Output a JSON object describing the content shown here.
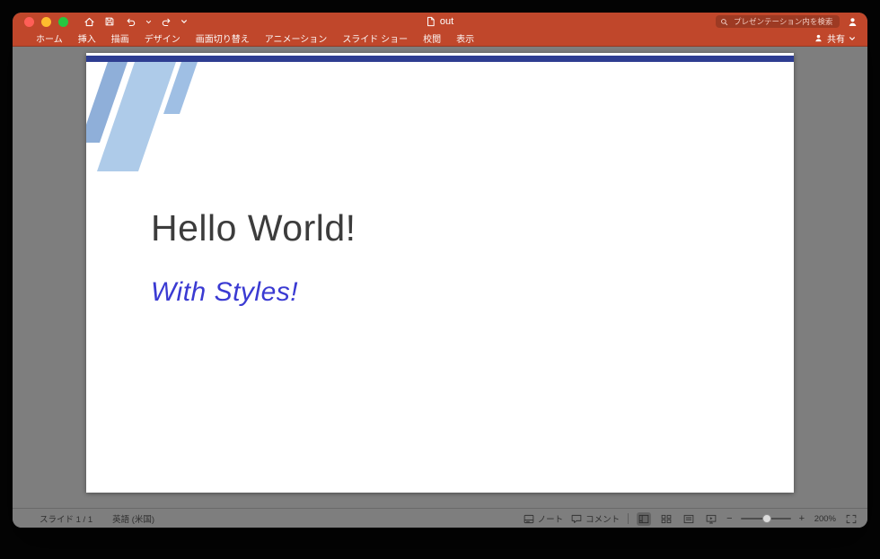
{
  "colors": {
    "titlebar_red": "#C0472B",
    "canvas_gray": "#7E7E7E",
    "slide_accent_navy": "#2E3D91",
    "stripe_medium_blue": "#8FAFD9",
    "stripe_light_blue": "#AECBE9",
    "stripe_soft_blue": "#9FBFE4",
    "slide_title_color": "#3C3C3C",
    "slide_subtitle_color": "#3A3AD2"
  },
  "titlebar": {
    "document_title": "out",
    "search_placeholder": "プレゼンテーション内を検索"
  },
  "ribbon": {
    "tabs": [
      {
        "label": "ホーム"
      },
      {
        "label": "挿入"
      },
      {
        "label": "描画"
      },
      {
        "label": "デザイン"
      },
      {
        "label": "画面切り替え"
      },
      {
        "label": "アニメーション"
      },
      {
        "label": "スライド ショー"
      },
      {
        "label": "校閲"
      },
      {
        "label": "表示"
      }
    ],
    "share_label": "共有"
  },
  "slide": {
    "title": "Hello World!",
    "subtitle": "With Styles!"
  },
  "statusbar": {
    "slide_indicator": "スライド 1 / 1",
    "language": "英語 (米国)",
    "notes_label": "ノート",
    "comments_label": "コメント",
    "zoom_minus": "−",
    "zoom_plus": "+",
    "zoom_level": "200%"
  }
}
